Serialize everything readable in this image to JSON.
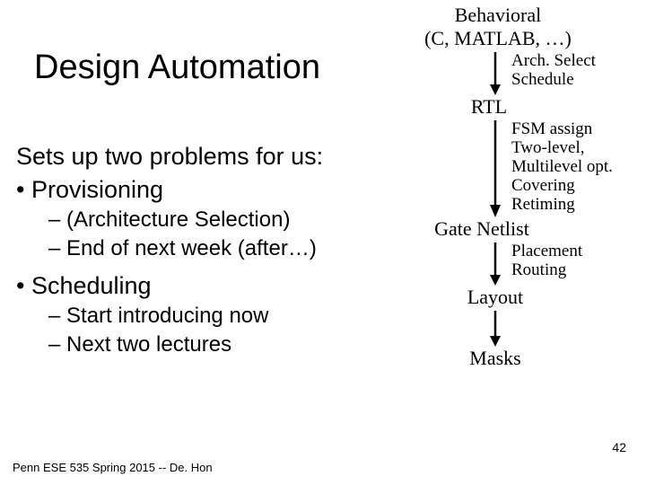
{
  "title": "Design Automation",
  "lead": "Sets up two problems for us:",
  "bullets": {
    "provisioning": "• Provisioning",
    "provisioning_sub1": "– (Architecture Selection)",
    "provisioning_sub2": "– End of next week (after…)",
    "scheduling": "• Scheduling",
    "scheduling_sub1": "– Start introducing now",
    "scheduling_sub2": "– Next two lectures"
  },
  "flow": {
    "behavioral_l1": "Behavioral",
    "behavioral_l2": "(C, MATLAB, …)",
    "step1_l1": "Arch. Select",
    "step1_l2": "Schedule",
    "rtl": "RTL",
    "step2_l1": "FSM assign",
    "step2_l2": "Two-level,",
    "step2_l3": "Multilevel opt.",
    "step2_l4": "Covering",
    "step2_l5": "Retiming",
    "gate": "Gate Netlist",
    "step3_l1": "Placement",
    "step3_l2": "Routing",
    "layout": "Layout",
    "masks": "Masks"
  },
  "slide_num": "42",
  "footer": "Penn ESE 535 Spring 2015 -- De. Hon"
}
